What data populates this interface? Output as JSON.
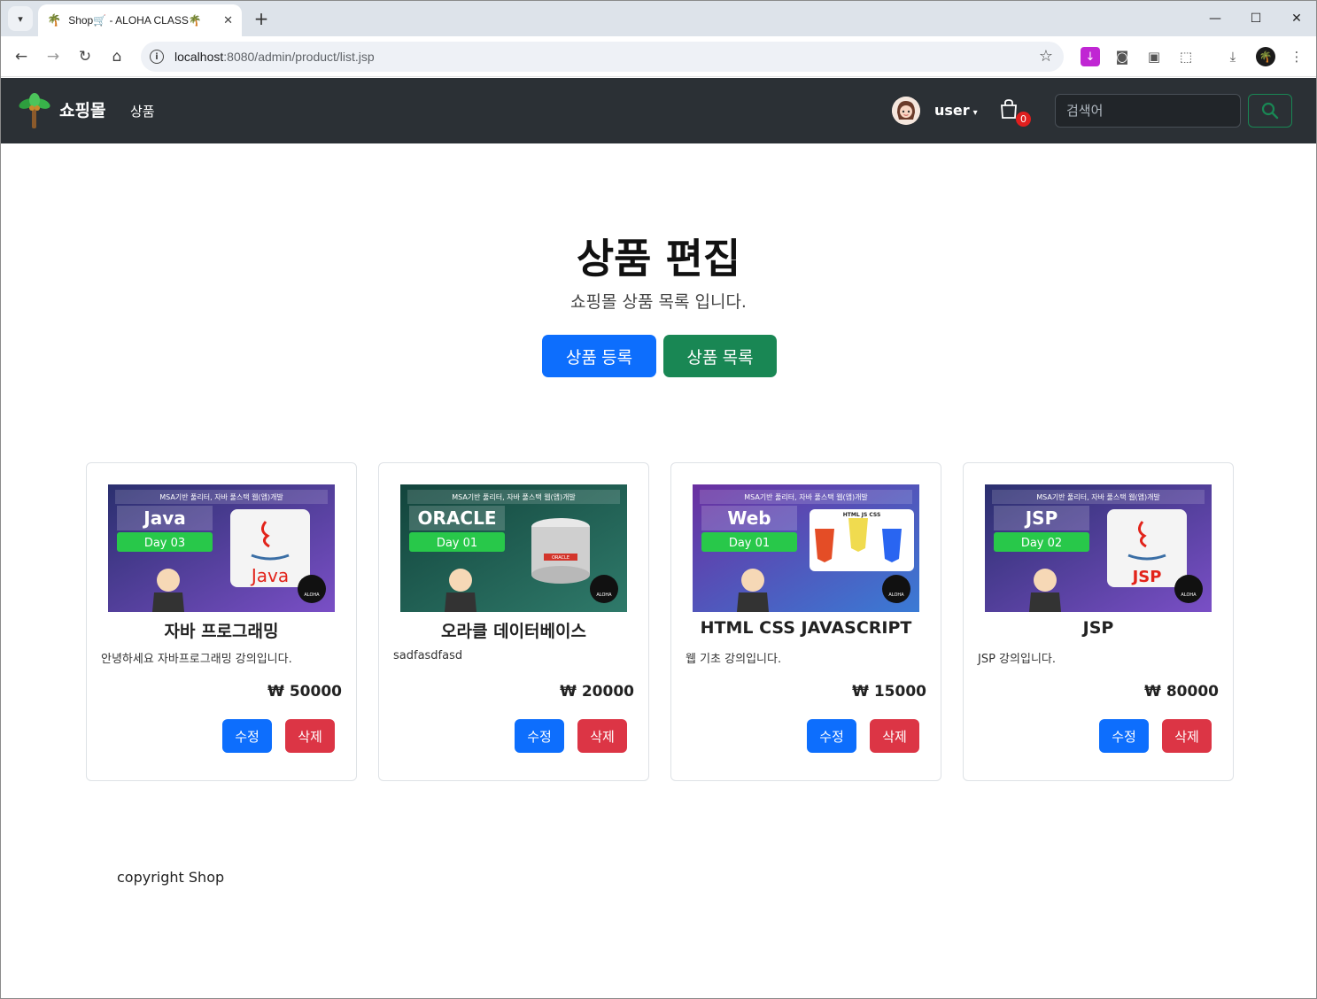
{
  "browser": {
    "tab_title": "Shop🛒 - ALOHA CLASS🌴",
    "url_host": "localhost",
    "url_path": ":8080/admin/product/list.jsp"
  },
  "navbar": {
    "brand": "쇼핑몰",
    "nav_link": "상품",
    "user": "user",
    "cart_count": "0",
    "search_placeholder": "검색어"
  },
  "hero": {
    "title": "상품 편집",
    "subtitle": "쇼핑몰 상품 목록 입니다.",
    "register_label": "상품 등록",
    "list_label": "상품 목록"
  },
  "products": [
    {
      "title": "자바 프로그래밍",
      "desc": "안녕하세요 자바프로그래밍 강의입니다.",
      "price": "₩ 50000",
      "edit": "수정",
      "delete": "삭제",
      "thumb": {
        "banner": "MSA기반 풀리터, 자바 풀스택 웹(앱)개발",
        "course": "Java",
        "day": "Day 03",
        "logo_text": "Java",
        "badge": "ALOHA",
        "accent": "#3b2f8f"
      }
    },
    {
      "title": "오라클 데이터베이스",
      "desc": "sadfasdfasd",
      "price": "₩ 20000",
      "edit": "수정",
      "delete": "삭제",
      "thumb": {
        "banner": "MSA기반 풀리터, 자바 풀스택 웹(앱)개발",
        "course": "ORACLE",
        "day": "Day 01",
        "logo_text": "ORACLE",
        "badge": "ALOHA",
        "accent": "#1d4f47"
      }
    },
    {
      "title": "HTML CSS JAVASCRIPT",
      "desc": "웹 기초 강의입니다.",
      "price": "₩ 15000",
      "edit": "수정",
      "delete": "삭제",
      "thumb": {
        "banner": "MSA기반 풀리터, 자바 풀스택 웹(앱)개발",
        "course": "Web",
        "day": "Day 01",
        "logo_text": "HTML JS CSS",
        "badge": "ALOHA",
        "accent": "#5b3aa8"
      }
    },
    {
      "title": "JSP",
      "desc": "JSP 강의입니다.",
      "price": "₩ 80000",
      "edit": "수정",
      "delete": "삭제",
      "thumb": {
        "banner": "MSA기반 풀리터, 자바 풀스택 웹(앱)개발",
        "course": "JSP",
        "day": "Day 02",
        "logo_text": "JSP",
        "badge": "ALOHA",
        "accent": "#3b2f8f"
      }
    }
  ],
  "footer": {
    "text": "copyright Shop"
  },
  "colors": {
    "primary": "#0d6efd",
    "success": "#198754",
    "danger": "#dc3545",
    "navbar": "#2b3035"
  }
}
